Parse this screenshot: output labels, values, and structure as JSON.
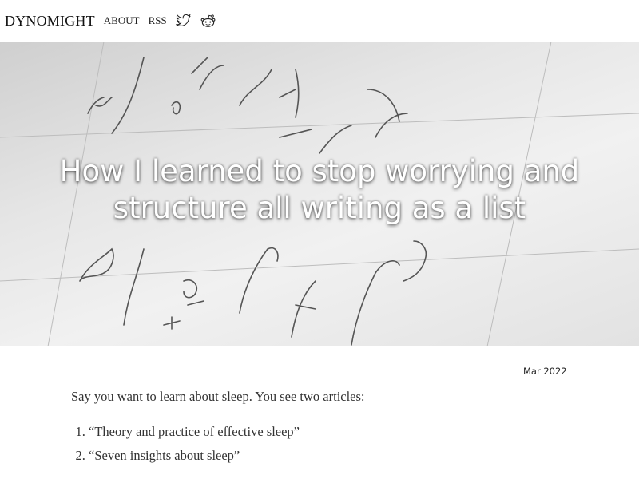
{
  "header": {
    "brand": "DYNOMIGHT",
    "nav": [
      {
        "label": "ABOUT"
      },
      {
        "label": "RSS"
      }
    ],
    "icons": [
      "twitter-icon",
      "reddit-icon"
    ]
  },
  "hero": {
    "title": "How I learned to stop worrying and structure all writing as a list"
  },
  "article": {
    "date": "Mar 2022",
    "intro": "Say you want to learn about sleep. You see two articles:",
    "items": [
      "“Theory and practice of effective sleep”",
      "“Seven insights about sleep”"
    ]
  }
}
